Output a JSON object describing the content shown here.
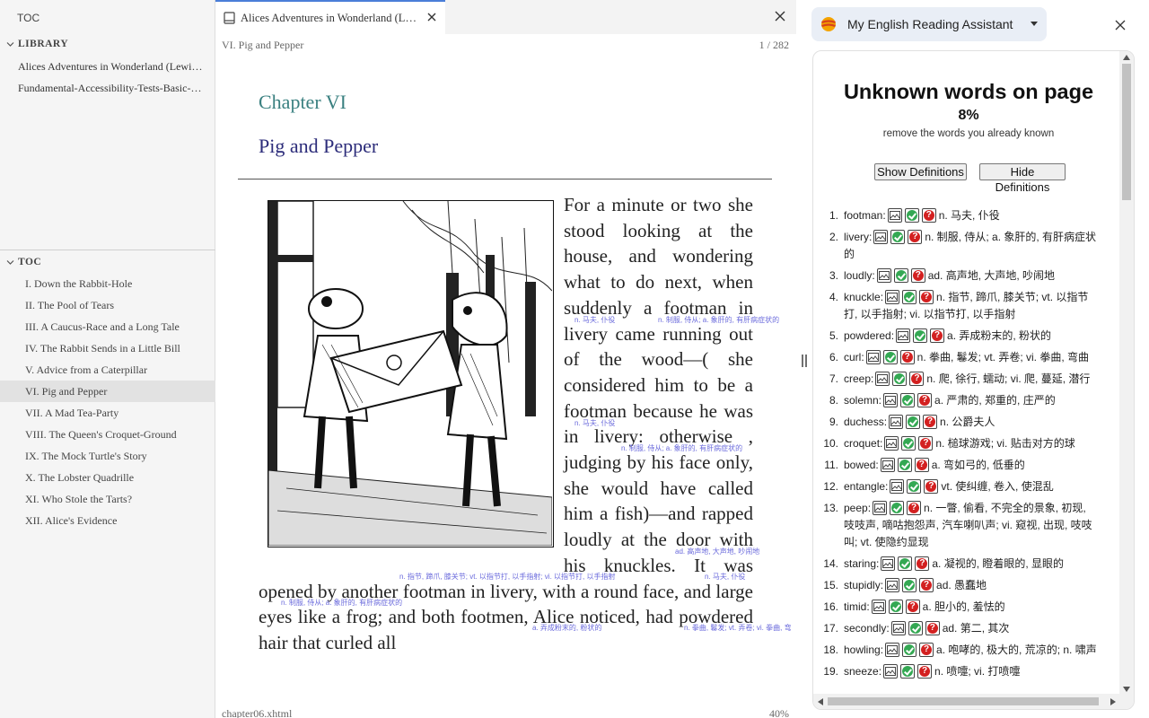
{
  "sidebar": {
    "header": "TOC",
    "library_title": "LIBRARY",
    "library_items": [
      "Alices Adventures in Wonderland (Lewis Carroll)",
      "Fundamental-Accessibility-Tests-Basic-Functionality"
    ],
    "toc_title": "TOC",
    "toc_items": [
      "I. Down the Rabbit-Hole",
      "II. The Pool of Tears",
      "III. A Caucus-Race and a Long Tale",
      "IV. The Rabbit Sends in a Little Bill",
      "V. Advice from a Caterpillar",
      "VI. Pig and Pepper",
      "VII. A Mad Tea-Party",
      "VIII. The Queen's Croquet-Ground",
      "IX. The Mock Turtle's Story",
      "X. The Lobster Quadrille",
      "XI. Who Stole the Tarts?",
      "XII. Alice's Evidence"
    ],
    "active_toc_index": 5
  },
  "reader": {
    "tab_title": "Alices Adventures in Wonderland (Lewis Carroll)",
    "chapter_name": "VI. Pig and Pepper",
    "page": "1 / 282",
    "chapter_heading": "Chapter VI",
    "chapter_title": "Pig and Pepper",
    "story_text": "For a minute or two she stood looking at the house, and wondering what to do next, when suddenly a footman in livery came running out of the wood—( she considered him to be a footman because he was in livery: otherwise , judging by his face only, she would have called him a fish)—and rapped loudly at the door with his knuckles. It was opened by another footman in livery, with a round face, and large eyes like a frog; and both footmen, Alice noticed, had powdered hair that curled all",
    "glosses": [
      "n. 马夫, 仆役",
      "n. 制服, 侍从; a. 象肝的, 有肝病症状的",
      "n. 马夫, 仆役",
      "n. 制服, 侍从; a. 象肝的, 有肝病症状的",
      "ad. 高声地, 大声地, 吵闹地",
      "n. 指节, 蹄爪, 膝关节; vt. 以指节打, 以手指射; vi. 以指节打, 以手指射",
      "n. 马夫, 仆役",
      "n. 制服, 侍从; a. 象肝的, 有肝病症状的",
      "a. 弄成粉末的, 粉状的",
      "n. 拳曲, 鬈发; vt. 弄卷; vi. 拳曲, 弯"
    ],
    "file_name": "chapter06.xhtml",
    "progress": "40%"
  },
  "assistant": {
    "name": "My English Reading Assistant",
    "title": "Unknown words on page",
    "percent": "8%",
    "hint": "remove the words you already known",
    "show_label": "Show Definitions",
    "hide_label": "Hide Definitions",
    "words": [
      {
        "n": "1.",
        "w": "footman:",
        "d": "n. 马夫, 仆役"
      },
      {
        "n": "2.",
        "w": "livery:",
        "d": "n. 制服, 侍从; a. 象肝的, 有肝病症状的"
      },
      {
        "n": "3.",
        "w": "loudly:",
        "d": "ad. 高声地, 大声地, 吵闹地"
      },
      {
        "n": "4.",
        "w": "knuckle:",
        "d": "n. 指节, 蹄爪, 膝关节; vt. 以指节打, 以手指射; vi. 以指节打, 以手指射"
      },
      {
        "n": "5.",
        "w": "powdered:",
        "d": "a. 弄成粉末的, 粉状的"
      },
      {
        "n": "6.",
        "w": "curl:",
        "d": "n. 拳曲, 鬈发; vt. 弄卷; vi. 拳曲, 弯曲"
      },
      {
        "n": "7.",
        "w": "creep:",
        "d": "n. 爬, 徐行, 蠕动; vi. 爬, 蔓延, 潜行"
      },
      {
        "n": "8.",
        "w": "solemn:",
        "d": "a. 严肃的, 郑重的, 庄严的"
      },
      {
        "n": "9.",
        "w": "duchess:",
        "d": "n. 公爵夫人"
      },
      {
        "n": "10.",
        "w": "croquet:",
        "d": "n. 槌球游戏; vi. 贴击对方的球"
      },
      {
        "n": "11.",
        "w": "bowed:",
        "d": "a. 弯如弓的, 低垂的"
      },
      {
        "n": "12.",
        "w": "entangle:",
        "d": "vt. 使纠缠, 卷入, 使混乱"
      },
      {
        "n": "13.",
        "w": "peep:",
        "d": "n. 一瞥, 偷看, 不完全的景象, 初现, 吱吱声, 嘀咕抱怨声, 汽车喇叭声; vi. 窥视, 出现, 吱吱叫; vt. 使隐约显现"
      },
      {
        "n": "14.",
        "w": "staring:",
        "d": "a. 凝视的, 瞪着眼的, 显眼的"
      },
      {
        "n": "15.",
        "w": "stupidly:",
        "d": "ad. 愚蠢地"
      },
      {
        "n": "16.",
        "w": "timid:",
        "d": "a. 胆小的, 羞怯的"
      },
      {
        "n": "17.",
        "w": "secondly:",
        "d": "ad. 第二, 其次"
      },
      {
        "n": "18.",
        "w": "howling:",
        "d": "a. 咆哮的, 极大的, 荒凉的; n. 啸声"
      },
      {
        "n": "19.",
        "w": "sneeze:",
        "d": "n. 喷嚏; vi. 打喷嚏"
      }
    ]
  },
  "colors": {
    "accent": "#4a7ed8",
    "chapter_heading": "#3a8080",
    "chapter_title": "#2c2c7a",
    "gloss": "#6b6bdc",
    "known": "#34a853",
    "unknown": "#d32020"
  }
}
